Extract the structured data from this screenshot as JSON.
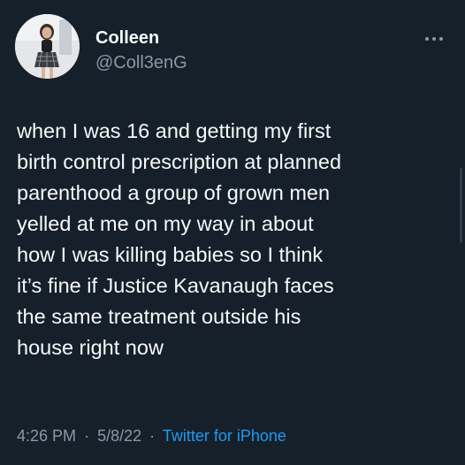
{
  "author": {
    "display_name": "Colleen",
    "handle": "@Coll3enG"
  },
  "tweet": {
    "lines": [
      "when I was 16 and getting my first",
      "birth control prescription at planned",
      "parenthood a group of grown men",
      "yelled at me on my way in about",
      "how I was killing babies so I think",
      "it’s fine if Justice Kavanaugh faces",
      "the same treatment outside his",
      "house right now"
    ]
  },
  "meta": {
    "time": "4:26 PM",
    "separator": "·",
    "date": "5/8/22",
    "source": "Twitter for iPhone"
  },
  "colors": {
    "background": "#15202b",
    "text": "#f7f9f9",
    "muted": "#8b98a5",
    "link": "#1d9bf0"
  },
  "icons": {
    "more": "more-horizontal-icon"
  }
}
